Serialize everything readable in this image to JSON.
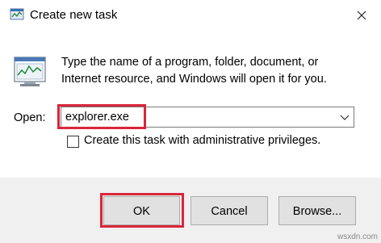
{
  "window": {
    "title": "Create new task",
    "title_icon": "run-icon",
    "close_icon": "close-icon"
  },
  "body": {
    "app_icon": "task-manager-icon",
    "description_line1": "Type the name of a program, folder, document, or",
    "description_line2": "Internet resource, and Windows will open it for you."
  },
  "open": {
    "label": "Open:",
    "value": "explorer.exe",
    "dropdown_icon": "chevron-down-icon"
  },
  "admin_checkbox": {
    "label": "Create this task with administrative privileges.",
    "checked": false
  },
  "buttons": {
    "ok": "OK",
    "cancel": "Cancel",
    "browse": "Browse..."
  },
  "highlight_color": "#d9263b",
  "watermark": "wsxdn.com"
}
